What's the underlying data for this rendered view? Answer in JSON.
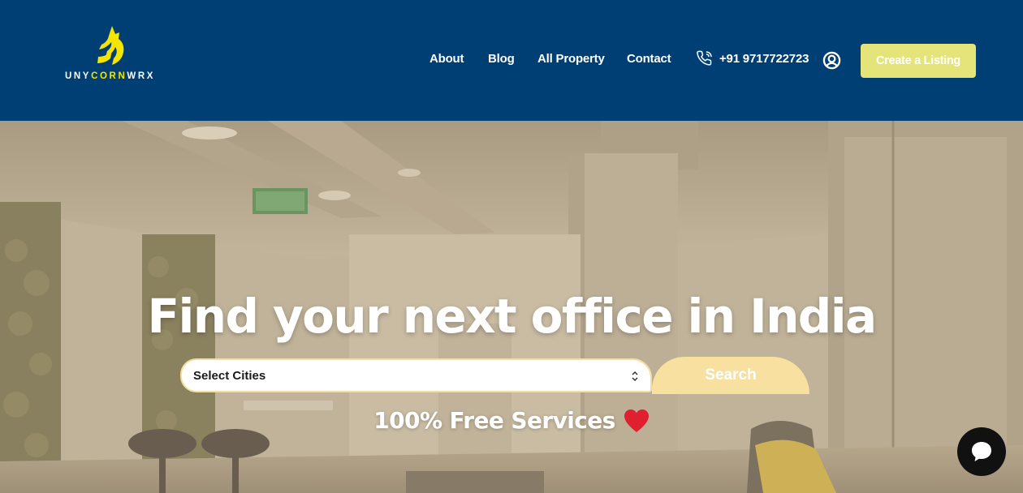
{
  "brand": {
    "logo_part1": "UNY",
    "logo_part2": "CORN",
    "logo_part3": "WRX",
    "logo_icon": "unicorn-horse-head-icon"
  },
  "nav": {
    "items": [
      {
        "label": "About"
      },
      {
        "label": "Blog"
      },
      {
        "label": "All Property"
      },
      {
        "label": "Contact"
      }
    ],
    "phone": "+91 9717722723",
    "phone_icon": "phone-icon",
    "account_icon": "user-account-icon",
    "cta_label": "Create a Listing"
  },
  "hero": {
    "title": "Find your next office in India",
    "select_label": "Select Cities",
    "search_label": "Search",
    "tagline": "100% Free Services",
    "tagline_icon": "heart-icon"
  },
  "chat": {
    "icon": "chat-bubble-icon"
  },
  "colors": {
    "header_bg": "#003f73",
    "logo_accent": "#f3e500",
    "cta_bg": "#e4e47a",
    "search_bg": "#f7e0a0",
    "heart": "#e0202e",
    "chat_bg": "#111111"
  }
}
